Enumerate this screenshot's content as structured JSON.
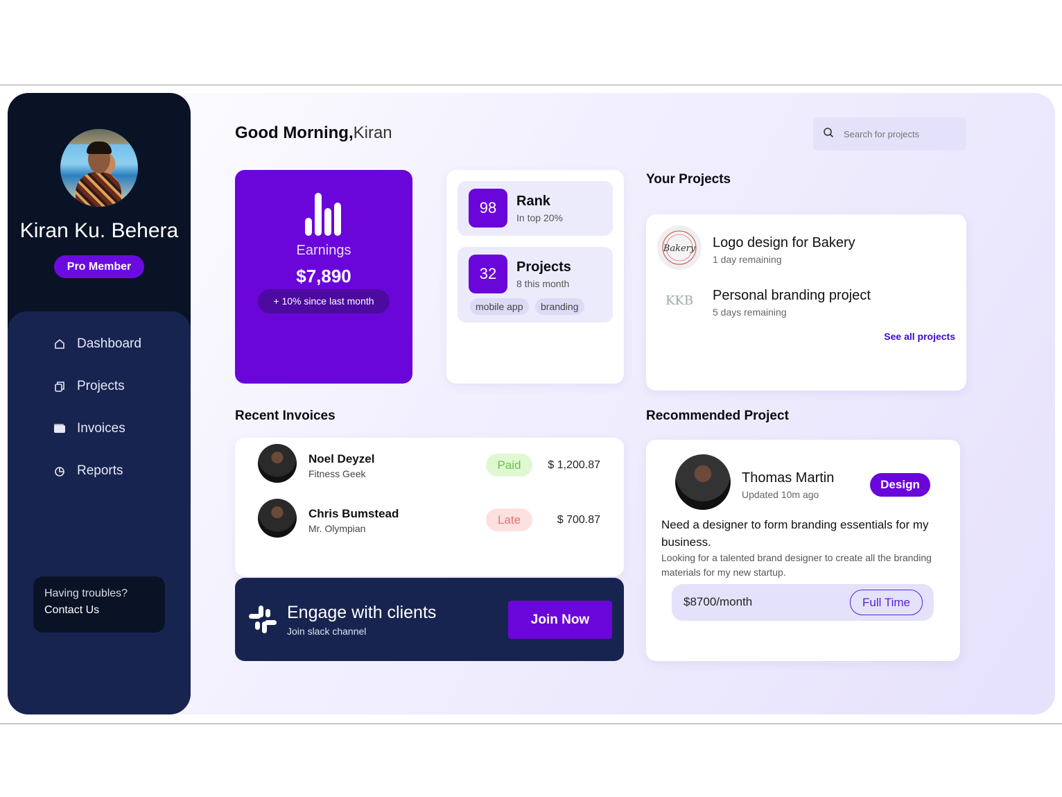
{
  "user": {
    "name": "Kiran Ku. Behera",
    "membership": "Pro Member"
  },
  "nav": [
    {
      "label": "Dashboard",
      "icon": "home-icon"
    },
    {
      "label": "Projects",
      "icon": "copy-icon"
    },
    {
      "label": "Invoices",
      "icon": "wallet-icon"
    },
    {
      "label": "Reports",
      "icon": "pie-chart-icon"
    }
  ],
  "help": {
    "line1": "Having troubles?",
    "line2": "Contact Us"
  },
  "greeting": {
    "salutation": "Good Morning,",
    "name": "Kiran"
  },
  "search": {
    "placeholder": "Search for projects"
  },
  "earnings": {
    "label": "Earnings",
    "value": "$7,890",
    "change": "+ 10% since last month"
  },
  "stats": {
    "rank": {
      "number": "98",
      "title": "Rank",
      "subtitle": "In top 20%"
    },
    "projects": {
      "number": "32",
      "title": "Projects",
      "subtitle": "8 this month",
      "tags": [
        "mobile app",
        "branding"
      ]
    }
  },
  "your_projects": {
    "title": "Your Projects",
    "items": [
      {
        "title": "Logo design for Bakery",
        "subtitle": "1 day remaining",
        "logo_text": "Bakery"
      },
      {
        "title": "Personal branding project",
        "subtitle": "5 days remaining",
        "logo_text": "KKB"
      }
    ],
    "see_all": "See all projects"
  },
  "invoices": {
    "title": "Recent Invoices",
    "rows": [
      {
        "name": "Noel Deyzel",
        "role": "Fitness Geek",
        "status": "Paid",
        "amount": "$ 1,200.87"
      },
      {
        "name": "Chris Bumstead",
        "role": "Mr. Olympian",
        "status": "Late",
        "amount": "$ 700.87"
      }
    ]
  },
  "engage": {
    "title": "Engage with clients",
    "subtitle": "Join slack channel",
    "button": "Join Now"
  },
  "recommended": {
    "title": "Recommended Project",
    "person": "Thomas Martin",
    "updated": "Updated 10m ago",
    "tag": "Design",
    "heading": "Need a designer to form branding essentials for my business.",
    "description": "Looking for a talented brand designer to create all the branding materials for my new startup.",
    "pay": "$8700/month",
    "type": "Full Time"
  },
  "colors": {
    "primary": "#6a06d9",
    "sidebar": "#0a1325",
    "sidebar_lower": "#182450",
    "paid": "#6cc24a",
    "late": "#e57373"
  }
}
